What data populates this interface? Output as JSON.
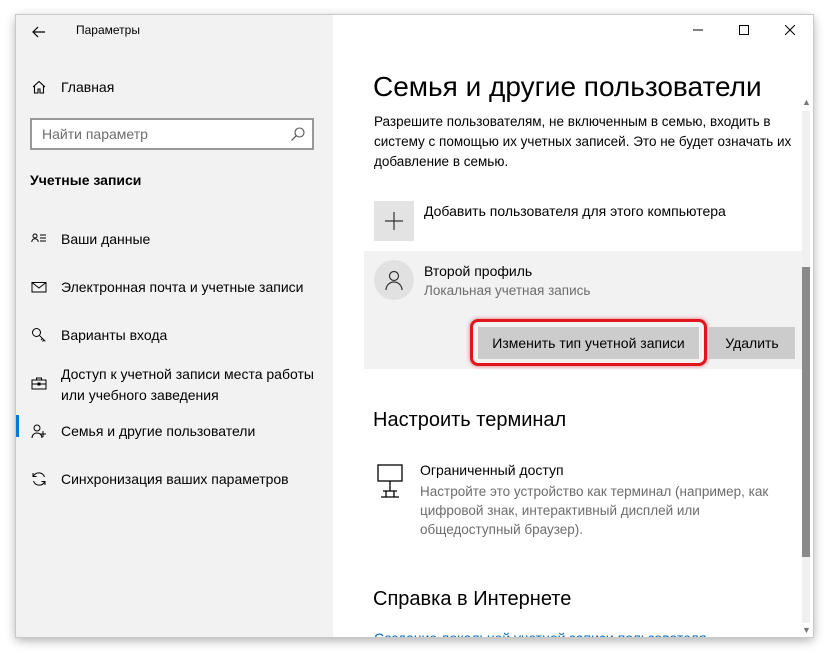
{
  "window": {
    "app_title": "Параметры",
    "controls": {
      "minimize": "—",
      "maximize": "☐",
      "close": "✕"
    }
  },
  "sidebar": {
    "home_label": "Главная",
    "search_placeholder": "Найти параметр",
    "section_title": "Учетные записи",
    "items": [
      {
        "label": "Ваши данные",
        "icon": "person-card-icon"
      },
      {
        "label": "Электронная почта и учетные записи",
        "icon": "mail-icon"
      },
      {
        "label": "Варианты входа",
        "icon": "key-icon"
      },
      {
        "label": "Доступ к учетной записи места работы или учебного заведения",
        "icon": "briefcase-icon"
      },
      {
        "label": "Семья и другие пользователи",
        "icon": "people-icon",
        "selected": true
      },
      {
        "label": "Синхронизация ваших параметров",
        "icon": "sync-icon"
      }
    ]
  },
  "main": {
    "title": "Семья и другие пользователи",
    "description": "Разрешите пользователям, не включенным в семью, входить в систему с помощью их учетных записей. Это не будет означать их добавление в семью.",
    "add_user_label": "Добавить пользователя для этого компьютера",
    "profile": {
      "name": "Второй профиль",
      "type": "Локальная учетная запись",
      "change_type_button": "Изменить тип учетной записи",
      "delete_button": "Удалить"
    },
    "kiosk": {
      "heading": "Настроить терминал",
      "title": "Ограниченный доступ",
      "description": "Настройте это устройство как терминал (например, как цифровой знак, интерактивный дисплей или общедоступный браузер)."
    },
    "help": {
      "heading": "Справка в Интернете",
      "link": "Создание локальной учетной записи пользователя"
    }
  },
  "colors": {
    "accent": "#0078d7",
    "highlight_border": "#e0161c",
    "sidebar_bg": "#f2f2f2",
    "button_bg": "#cccccc"
  }
}
